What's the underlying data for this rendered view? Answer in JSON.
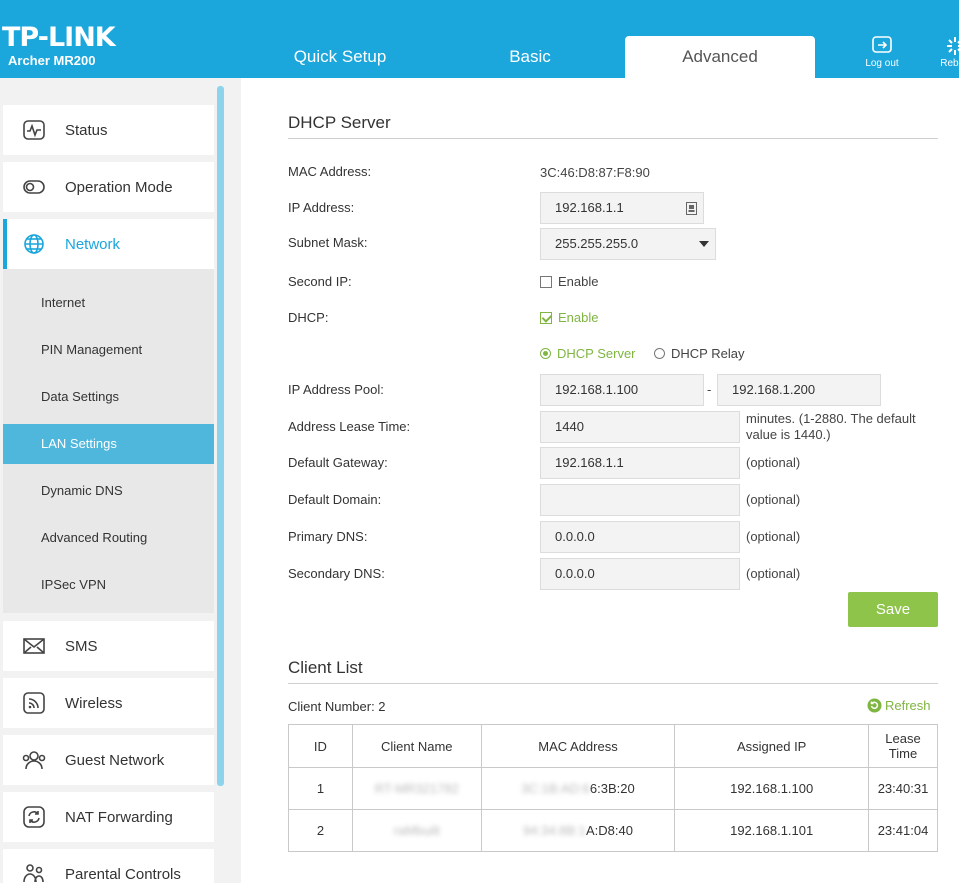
{
  "brand": {
    "logo": "TP-LINK",
    "model": "Archer MR200"
  },
  "tabs": [
    {
      "label": "Quick Setup"
    },
    {
      "label": "Basic"
    },
    {
      "label": "Advanced"
    }
  ],
  "header_buttons": {
    "logout": "Log out",
    "reboot": "Reboo"
  },
  "sidebar": {
    "items": [
      {
        "label": "Status",
        "icon": "pulse-icon"
      },
      {
        "label": "Operation Mode",
        "icon": "toggle-icon"
      },
      {
        "label": "Network",
        "icon": "globe-icon"
      },
      {
        "label": "SMS",
        "icon": "envelope-icon"
      },
      {
        "label": "Wireless",
        "icon": "wifi-icon"
      },
      {
        "label": "Guest Network",
        "icon": "guests-icon"
      },
      {
        "label": "NAT Forwarding",
        "icon": "refresh-circle-icon"
      },
      {
        "label": "Parental Controls",
        "icon": "family-icon"
      }
    ],
    "network_sub": [
      "Internet",
      "PIN Management",
      "Data Settings",
      "LAN Settings",
      "Dynamic DNS",
      "Advanced Routing",
      "IPSec VPN"
    ]
  },
  "dhcp": {
    "title": "DHCP Server",
    "mac_label": "MAC Address:",
    "mac_value": "3C:46:D8:87:F8:90",
    "ip_label": "IP Address:",
    "ip_value": "192.168.1.1",
    "subnet_label": "Subnet Mask:",
    "subnet_value": "255.255.255.0",
    "second_ip_label": "Second IP:",
    "second_ip_enable": "Enable",
    "dhcp_label": "DHCP:",
    "dhcp_enable": "Enable",
    "mode_server": "DHCP Server",
    "mode_relay": "DHCP Relay",
    "pool_label": "IP Address Pool:",
    "pool_start": "192.168.1.100",
    "pool_sep": "-",
    "pool_end": "192.168.1.200",
    "lease_label": "Address Lease Time:",
    "lease_value": "1440",
    "lease_note_1": "minutes. (1-2880. The default",
    "lease_note_2": "value is 1440.)",
    "gateway_label": "Default Gateway:",
    "gateway_value": "192.168.1.1",
    "domain_label": "Default Domain:",
    "domain_value": "",
    "pdns_label": "Primary DNS:",
    "pdns_value": "0.0.0.0",
    "sdns_label": "Secondary DNS:",
    "sdns_value": "0.0.0.0",
    "optional": "(optional)",
    "save": "Save"
  },
  "clients": {
    "title": "Client List",
    "count_label": "Client Number: 2",
    "refresh": "Refresh",
    "headers": [
      "ID",
      "Client Name",
      "MAC Address",
      "Assigned IP",
      "Lease",
      "Time"
    ],
    "rows": [
      {
        "id": "1",
        "name": "RT-MR321782",
        "mac_hidden": "3C:1B:AD:6",
        "mac_tail": "6:3B:20",
        "ip": "192.168.1.100",
        "lease": "23:40:31"
      },
      {
        "id": "2",
        "name": "raMbuilt",
        "mac_hidden": "94:34:8B:1",
        "mac_tail": "A:D8:40",
        "ip": "192.168.1.101",
        "lease": "23:41:04"
      }
    ]
  },
  "colors": {
    "header": "#1ba6dc",
    "accent_green": "#8dc449",
    "active_sub": "#4fb6dc"
  }
}
